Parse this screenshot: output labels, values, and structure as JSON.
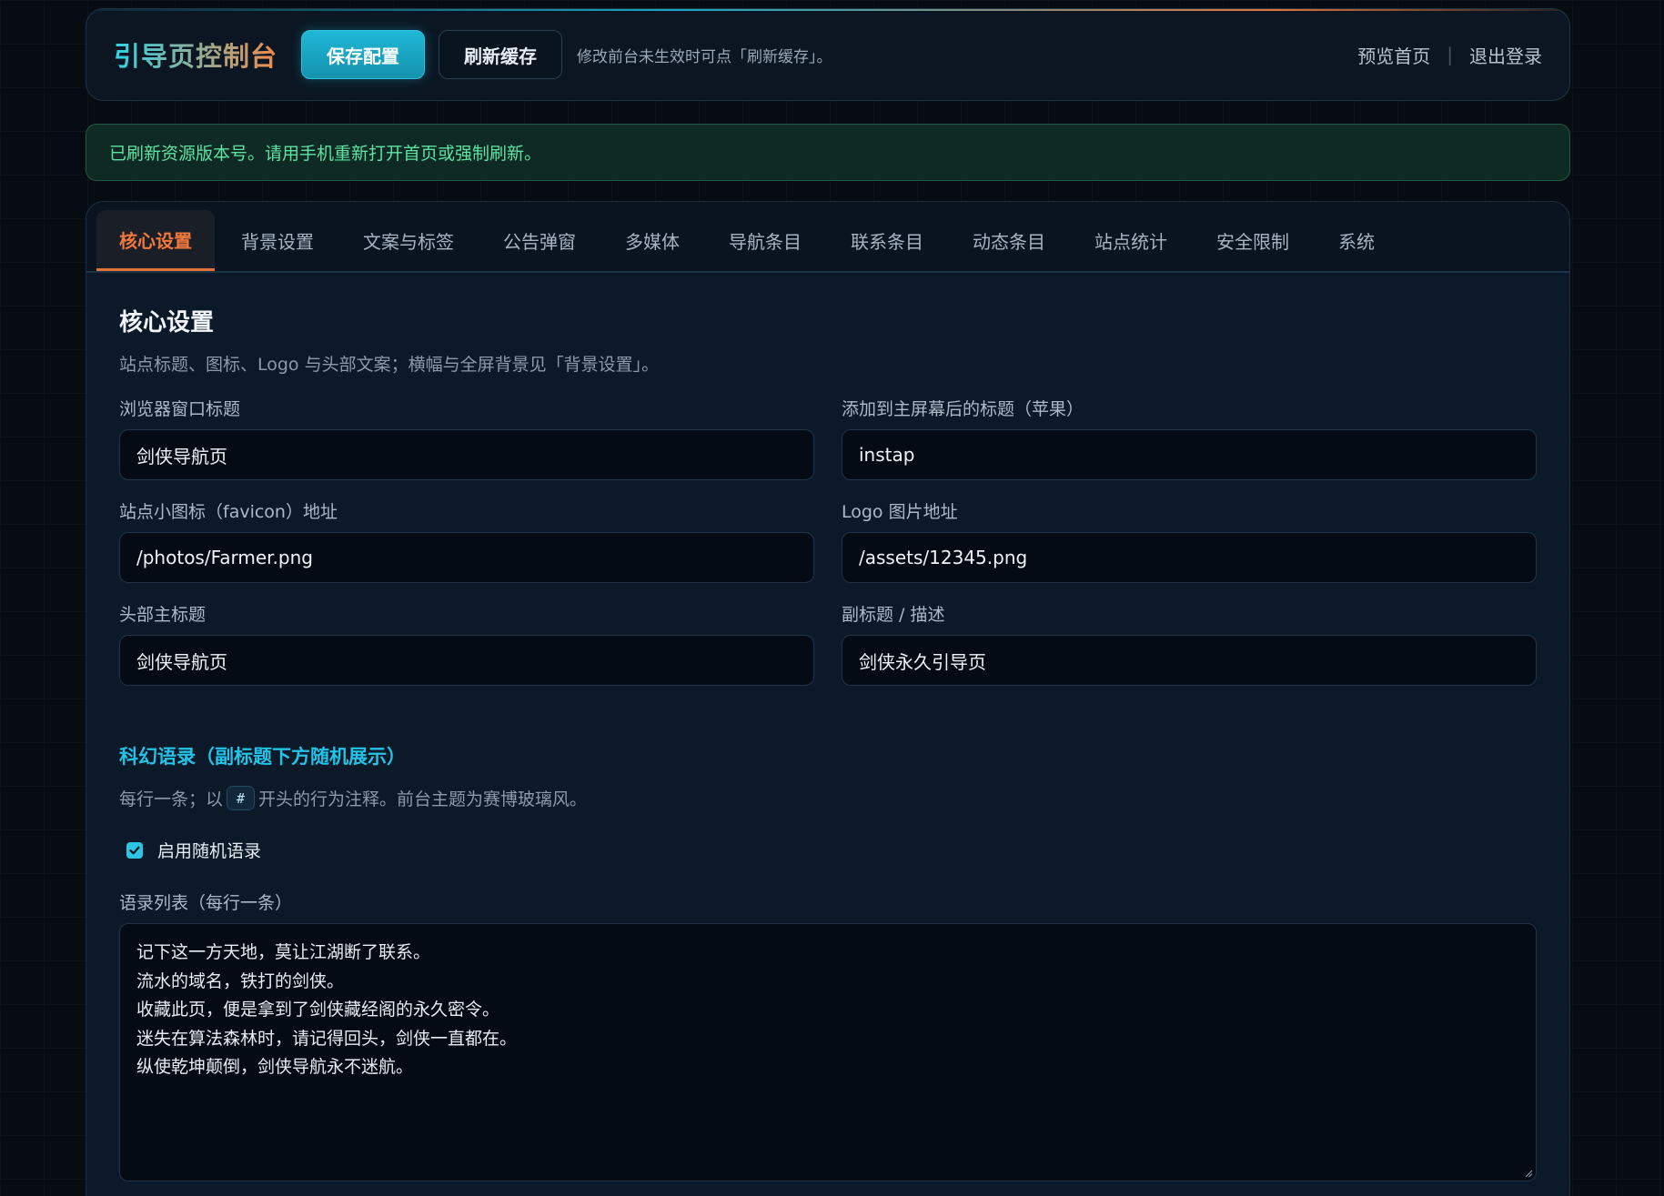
{
  "header": {
    "brand": "引导页控制台",
    "save_label": "保存配置",
    "refresh_label": "刷新缓存",
    "hint": "修改前台未生效时可点「刷新缓存」。",
    "preview_label": "预览首页",
    "separator": "|",
    "logout_label": "退出登录"
  },
  "notice": {
    "text": "已刷新资源版本号。请用手机重新打开首页或强制刷新。"
  },
  "tabs": [
    {
      "label": "核心设置",
      "active": true
    },
    {
      "label": "背景设置"
    },
    {
      "label": "文案与标签"
    },
    {
      "label": "公告弹窗"
    },
    {
      "label": "多媒体"
    },
    {
      "label": "导航条目"
    },
    {
      "label": "联系条目"
    },
    {
      "label": "动态条目"
    },
    {
      "label": "站点统计"
    },
    {
      "label": "安全限制"
    },
    {
      "label": "系统"
    }
  ],
  "core": {
    "title": "核心设置",
    "desc": "站点标题、图标、Logo 与头部文案；横幅与全屏背景见「背景设置」。",
    "fields": [
      {
        "label": "浏览器窗口标题",
        "value": "剑侠导航页"
      },
      {
        "label": "添加到主屏幕后的标题（苹果）",
        "value": "instap"
      },
      {
        "label": "站点小图标（favicon）地址",
        "value": "/photos/Farmer.png"
      },
      {
        "label": "Logo 图片地址",
        "value": "/assets/12345.png"
      },
      {
        "label": "头部主标题",
        "value": "剑侠导航页"
      },
      {
        "label": "副标题 / 描述",
        "value": "剑侠永久引导页"
      }
    ]
  },
  "quotes": {
    "title": "科幻语录（副标题下方随机展示）",
    "desc_before": "每行一条；以",
    "desc_code": "#",
    "desc_after": "开头的行为注释。前台主题为赛博玻璃风。",
    "enable_label": "启用随机语录",
    "enabled": true,
    "list_label": "语录列表（每行一条）",
    "lines": [
      "记下这一方天地，莫让江湖断了联系。",
      "流水的域名，铁打的剑侠。",
      "收藏此页，便是拿到了剑侠藏经阁的永久密令。",
      "迷失在算法森林时，请记得回头，剑侠一直都在。",
      "纵使乾坤颠倒，剑侠导航永不迷航。"
    ]
  },
  "colors": {
    "accent_cyan": "#1fb8d6",
    "accent_orange": "#e2743a",
    "success_green": "#5ee3a4",
    "background": "#070b12"
  }
}
